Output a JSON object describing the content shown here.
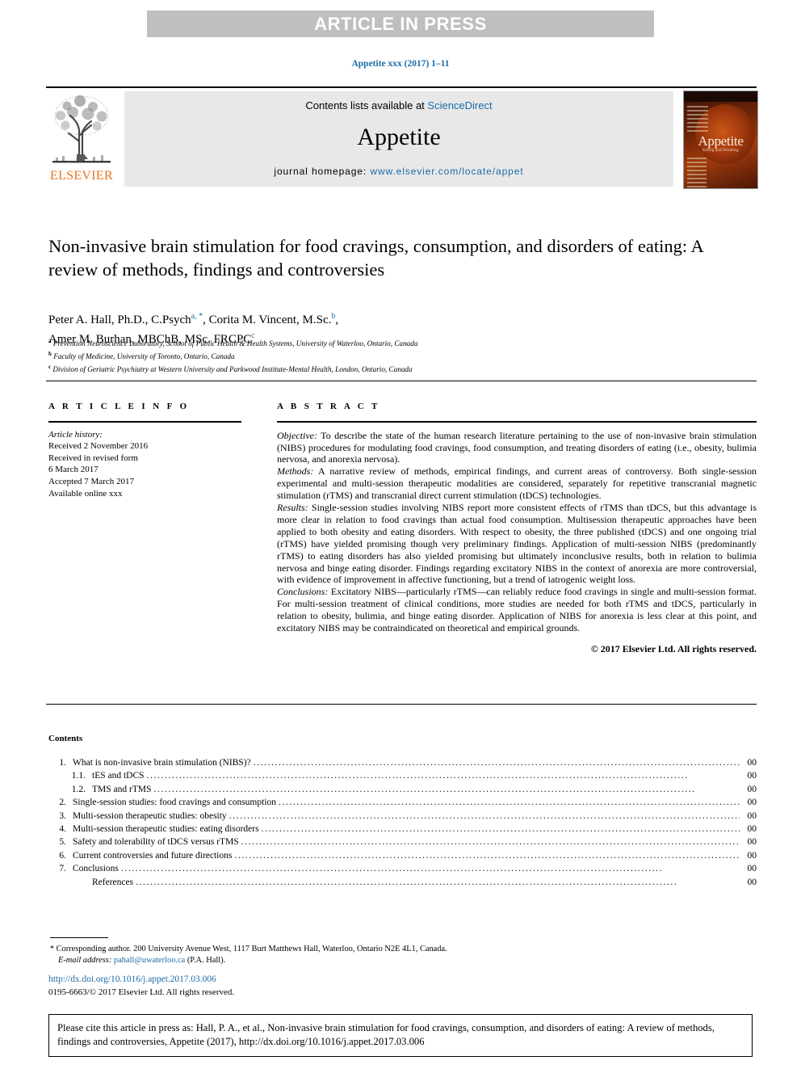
{
  "banner": {
    "text": "ARTICLE IN PRESS"
  },
  "running_head": "Appetite xxx (2017) 1–11",
  "masthead": {
    "contents_prefix": "Contents lists available at ",
    "sciencedirect": "ScienceDirect",
    "journal_title": "Appetite",
    "homepage_prefix": "journal homepage: ",
    "homepage_url": "www.elsevier.com/locate/appet",
    "publisher": "ELSEVIER",
    "cover_title": "Appetite",
    "cover_subtitle": "Eating and Drinking"
  },
  "article": {
    "title": "Non-invasive brain stimulation for food cravings, consumption, and disorders of eating: A review of methods, findings and controversies",
    "authors_line1_a": "Peter A. Hall, Ph.D., C.Psych",
    "authors_line1_mark1": "a, *",
    "authors_line1_b": ", Corita M. Vincent, M.Sc.",
    "authors_line1_mark2": "b",
    "authors_line1_c": ",",
    "authors_line2_a": "Amer M. Burhan, MBChB, MSc. FRCPC",
    "authors_line2_mark": "c",
    "affiliations": [
      {
        "mark": "a",
        "text": "Prevention Neuroscience Laboratory, School of Public Health & Health Systems, University of Waterloo, Ontario, Canada"
      },
      {
        "mark": "b",
        "text": "Faculty of Medicine, University of Toronto, Ontario, Canada"
      },
      {
        "mark": "c",
        "text": "Division of Geriatric Psychiatry at Western University and Parkwood Institute-Mental Health, London, Ontario, Canada"
      }
    ]
  },
  "article_info": {
    "heading": "A R T I C L E  I N F O",
    "history_label": "Article history:",
    "lines": [
      "Received 2 November 2016",
      "Received in revised form",
      "6 March 2017",
      "Accepted 7 March 2017",
      "Available online xxx"
    ]
  },
  "abstract": {
    "heading": "A B S T R A C T",
    "objective_label": "Objective:",
    "objective_text": " To describe the state of the human research literature pertaining to the use of non-invasive brain stimulation (NIBS) procedures for modulating food cravings, food consumption, and treating disorders of eating (i.e., obesity, bulimia nervosa, and anorexia nervosa).",
    "methods_label": "Methods:",
    "methods_text": " A narrative review of methods, empirical findings, and current areas of controversy. Both single-session experimental and multi-session therapeutic modalities are considered, separately for repetitive transcranial magnetic stimulation (rTMS) and transcranial direct current stimulation (tDCS) technologies.",
    "results_label": "Results:",
    "results_text": " Single-session studies involving NIBS report more consistent effects of rTMS than tDCS, but this advantage is more clear in relation to food cravings than actual food consumption. Multisession therapeutic approaches have been applied to both obesity and eating disorders. With respect to obesity, the three published (tDCS) and one ongoing trial (rTMS) have yielded promising though very preliminary findings. Application of multi-session NIBS (predominantly rTMS) to eating disorders has also yielded promising but ultimately inconclusive results, both in relation to bulimia nervosa and binge eating disorder. Findings regarding excitatory NIBS in the context of anorexia are more controversial, with evidence of improvement in affective functioning, but a trend of iatrogenic weight loss.",
    "conclusions_label": "Conclusions:",
    "conclusions_text": " Excitatory NIBS—particularly rTMS—can reliably reduce food cravings in single and multi-session format. For multi-session treatment of clinical conditions, more studies are needed for both rTMS and tDCS, particularly in relation to obesity, bulimia, and binge eating disorder. Application of NIBS for anorexia is less clear at this point, and excitatory NIBS may be contraindicated on theoretical and empirical grounds.",
    "copyright": "© 2017 Elsevier Ltd. All rights reserved."
  },
  "contents": {
    "heading": "Contents",
    "entries": [
      {
        "num": "1.",
        "level": 1,
        "label": "What is non-invasive brain stimulation (NIBS)?",
        "page": "00"
      },
      {
        "num": "1.1.",
        "level": 2,
        "label": "tES and tDCS",
        "page": "00"
      },
      {
        "num": "1.2.",
        "level": 2,
        "label": "TMS and rTMS",
        "page": "00"
      },
      {
        "num": "2.",
        "level": 1,
        "label": "Single-session studies: food cravings and consumption",
        "page": "00"
      },
      {
        "num": "3.",
        "level": 1,
        "label": "Multi-session therapeutic studies: obesity",
        "page": "00"
      },
      {
        "num": "4.",
        "level": 1,
        "label": "Multi-session therapeutic studies: eating disorders",
        "page": "00"
      },
      {
        "num": "5.",
        "level": 1,
        "label": "Safety and tolerability of tDCS versus rTMS",
        "page": "00"
      },
      {
        "num": "6.",
        "level": 1,
        "label": "Current controversies and future directions",
        "page": "00"
      },
      {
        "num": "7.",
        "level": 1,
        "label": "Conclusions",
        "page": "00"
      },
      {
        "num": "",
        "level": 2,
        "label": "References",
        "page": "00"
      }
    ]
  },
  "footnotes": {
    "corresponding_star": "*",
    "corresponding_text": " Corresponding author. 200 University Avenue West, 1117 Burt Matthews Hall, Waterloo, Ontario N2E 4L1, Canada.",
    "email_label": "E-mail address:",
    "email": "pahall@uwaterloo.ca",
    "email_suffix": " (P.A. Hall).",
    "doi": "http://dx.doi.org/10.1016/j.appet.2017.03.006",
    "issn": "0195-6663/© 2017 Elsevier Ltd. All rights reserved."
  },
  "cite_box": {
    "text": "Please cite this article in press as: Hall, P. A., et al., Non-invasive brain stimulation for food cravings, consumption, and disorders of eating: A review of methods, findings and controversies, Appetite (2017), http://dx.doi.org/10.1016/j.appet.2017.03.006"
  },
  "colors": {
    "link": "#1b6ca8",
    "banner_bg": "#bfbfbf",
    "masthead_bg": "#e8e8e8",
    "elsevier_orange": "#e8741c"
  }
}
